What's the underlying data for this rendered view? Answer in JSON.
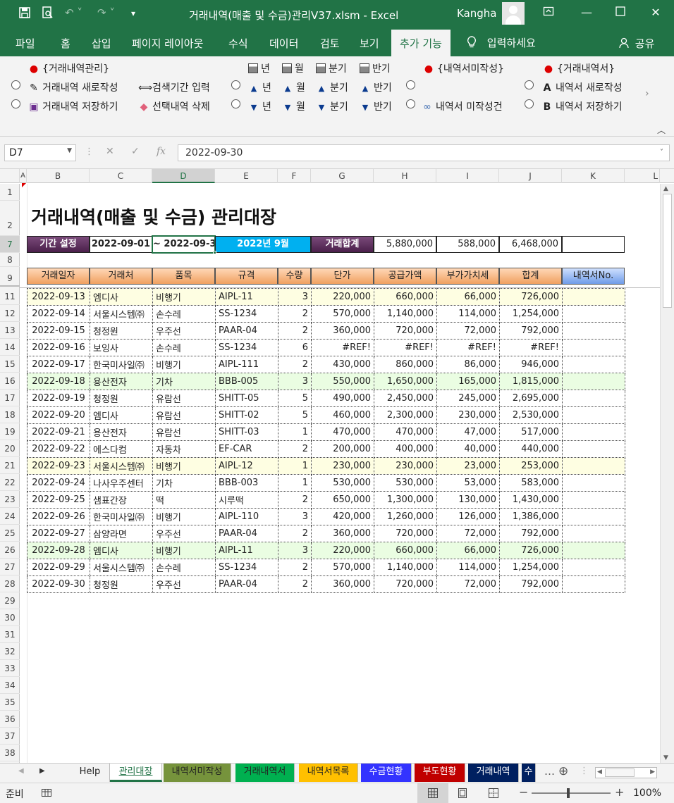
{
  "window": {
    "title": "거래내역(매출 및 수금)관리V37.xlsm  -  Excel",
    "user": "Kangha"
  },
  "ribbon_tabs": [
    "파일",
    "홈",
    "삽입",
    "페이지 레이아웃",
    "수식",
    "데이터",
    "검토",
    "보기",
    "추가 기능"
  ],
  "tell_me": "입력하세요",
  "share": "공유",
  "ribbon": {
    "group1_title": "{거래내역관리}",
    "new_trade": "거래내역 새로작성",
    "save_trade": "거래내역 저장하기",
    "search_period": "검색기간 입력",
    "delete_selected": "선택내역 삭제",
    "year": "년",
    "month": "월",
    "quarter": "분기",
    "half": "반기",
    "group2_title": "{내역서미작성}",
    "not_created": "내역서 미작성건",
    "group3_title": "{거래내역서}",
    "new_statement": "내역서 새로작성",
    "save_statement": "내역서 저장하기",
    "letter_a": "A",
    "letter_b": "B"
  },
  "formula_bar": {
    "name_box": "D7",
    "value": "2022-09-30"
  },
  "columns": [
    "A",
    "B",
    "C",
    "D",
    "E",
    "F",
    "G",
    "H",
    "I",
    "J",
    "K",
    "L"
  ],
  "rows": [
    "1",
    "2",
    "7",
    "8",
    "9",
    "11",
    "12",
    "13",
    "14",
    "15",
    "16",
    "17",
    "18",
    "19",
    "20",
    "21",
    "22",
    "23",
    "24",
    "25",
    "26",
    "27",
    "28",
    "29",
    "30",
    "31",
    "32",
    "33",
    "34",
    "35",
    "36",
    "37",
    "38"
  ],
  "sheet": {
    "title": "거래내역(매출 및 수금) 관리대장",
    "period_label": "기간 설정",
    "period_start": "2022-09-01",
    "period_end": "~ 2022-09-30",
    "period_text": "2022년 9월",
    "total_label": "거래합계",
    "total_supply": "5,880,000",
    "total_vat": "588,000",
    "total_sum": "6,468,000",
    "headers": [
      "거래일자",
      "거래처",
      "품목",
      "규격",
      "수량",
      "단가",
      "공급가액",
      "부가가치세",
      "합계",
      "내역서No."
    ],
    "data": [
      [
        "2022-09-13",
        "엠디사",
        "비행기",
        "AIPL-11",
        "3",
        "220,000",
        "660,000",
        "66,000",
        "726,000",
        ""
      ],
      [
        "2022-09-14",
        "서울시스템㈜",
        "손수레",
        "SS-1234",
        "2",
        "570,000",
        "1,140,000",
        "114,000",
        "1,254,000",
        ""
      ],
      [
        "2022-09-15",
        "청정원",
        "우주선",
        "PAAR-04",
        "2",
        "360,000",
        "720,000",
        "72,000",
        "792,000",
        ""
      ],
      [
        "2022-09-16",
        "보잉사",
        "손수레",
        "SS-1234",
        "6",
        "#REF!",
        "#REF!",
        "#REF!",
        "#REF!",
        ""
      ],
      [
        "2022-09-17",
        "한국미사일㈜",
        "비행기",
        "AIPL-111",
        "2",
        "430,000",
        "860,000",
        "86,000",
        "946,000",
        ""
      ],
      [
        "2022-09-18",
        "용산전자",
        "기차",
        "BBB-005",
        "3",
        "550,000",
        "1,650,000",
        "165,000",
        "1,815,000",
        ""
      ],
      [
        "2022-09-19",
        "청정원",
        "유람선",
        "SHITT-05",
        "5",
        "490,000",
        "2,450,000",
        "245,000",
        "2,695,000",
        ""
      ],
      [
        "2022-09-20",
        "엠디사",
        "유람선",
        "SHITT-02",
        "5",
        "460,000",
        "2,300,000",
        "230,000",
        "2,530,000",
        ""
      ],
      [
        "2022-09-21",
        "용산전자",
        "유람선",
        "SHITT-03",
        "1",
        "470,000",
        "470,000",
        "47,000",
        "517,000",
        ""
      ],
      [
        "2022-09-22",
        "에스다컴",
        "자동차",
        "EF-CAR",
        "2",
        "200,000",
        "400,000",
        "40,000",
        "440,000",
        ""
      ],
      [
        "2022-09-23",
        "서울시스템㈜",
        "비행기",
        "AIPL-12",
        "1",
        "230,000",
        "230,000",
        "23,000",
        "253,000",
        ""
      ],
      [
        "2022-09-24",
        "나사우주센터",
        "기차",
        "BBB-003",
        "1",
        "530,000",
        "530,000",
        "53,000",
        "583,000",
        ""
      ],
      [
        "2022-09-25",
        "샘표간장",
        "떡",
        "시루떡",
        "2",
        "650,000",
        "1,300,000",
        "130,000",
        "1,430,000",
        ""
      ],
      [
        "2022-09-26",
        "한국미사일㈜",
        "비행기",
        "AIPL-110",
        "3",
        "420,000",
        "1,260,000",
        "126,000",
        "1,386,000",
        ""
      ],
      [
        "2022-09-27",
        "삼양라면",
        "우주선",
        "PAAR-04",
        "2",
        "360,000",
        "720,000",
        "72,000",
        "792,000",
        ""
      ],
      [
        "2022-09-28",
        "엠디사",
        "비행기",
        "AIPL-11",
        "3",
        "220,000",
        "660,000",
        "66,000",
        "726,000",
        ""
      ],
      [
        "2022-09-29",
        "서울시스템㈜",
        "손수레",
        "SS-1234",
        "2",
        "570,000",
        "1,140,000",
        "114,000",
        "1,254,000",
        ""
      ],
      [
        "2022-09-30",
        "청정원",
        "우주선",
        "PAAR-04",
        "2",
        "360,000",
        "720,000",
        "72,000",
        "792,000",
        ""
      ]
    ]
  },
  "sheet_tabs": [
    {
      "label": "Help",
      "bg": "#f3f3f3",
      "fg": "#222"
    },
    {
      "label": "관리대장",
      "bg": "#ffffff",
      "fg": "#217346"
    },
    {
      "label": "내역서미작성",
      "bg": "#76933c",
      "fg": "#222"
    },
    {
      "label": "거래내역서",
      "bg": "#00b050",
      "fg": "#222"
    },
    {
      "label": "내역서목록",
      "bg": "#ffc000",
      "fg": "#222"
    },
    {
      "label": "수금현황",
      "bg": "#3333ff",
      "fg": "#ffffff"
    },
    {
      "label": "부도현황",
      "bg": "#c00000",
      "fg": "#ffffff"
    },
    {
      "label": "거래내역",
      "bg": "#002060",
      "fg": "#ffffff"
    },
    {
      "label": "수",
      "bg": "#002060",
      "fg": "#ffffff"
    }
  ],
  "status": {
    "ready": "준비",
    "zoom": "100%"
  },
  "colors": {
    "excel_green": "#217346",
    "period_label_bg": "#5a2d5a",
    "period_text_bg": "#00b0f0",
    "row_yellow": "#fefee2",
    "row_green": "#eafde2"
  }
}
